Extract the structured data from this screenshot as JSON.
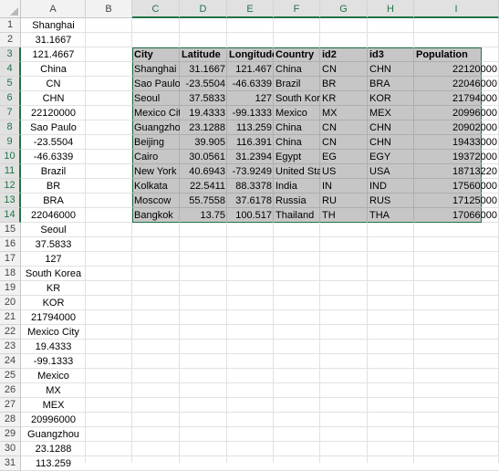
{
  "column_headers": [
    "A",
    "B",
    "C",
    "D",
    "E",
    "F",
    "G",
    "H",
    "I"
  ],
  "row_numbers": [
    "1",
    "2",
    "3",
    "4",
    "5",
    "6",
    "7",
    "8",
    "9",
    "10",
    "11",
    "12",
    "13",
    "14",
    "15",
    "16",
    "17",
    "18",
    "19",
    "20",
    "21",
    "22",
    "23",
    "24",
    "25",
    "26",
    "27",
    "28",
    "29",
    "30",
    "31"
  ],
  "column_a": [
    "Shanghai",
    "31.1667",
    "121.4667",
    "China",
    "CN",
    "CHN",
    "22120000",
    "Sao Paulo",
    "-23.5504",
    "-46.6339",
    "Brazil",
    "BR",
    "BRA",
    "22046000",
    "Seoul",
    "37.5833",
    "127",
    "South Korea",
    "KR",
    "KOR",
    "21794000",
    "Mexico City",
    "19.4333",
    "-99.1333",
    "Mexico",
    "MX",
    "MEX",
    "20996000",
    "Guangzhou",
    "23.1288",
    "113.259"
  ],
  "table": {
    "headers": [
      "City",
      "Latitude",
      "Longitude",
      "Country",
      "id2",
      "id3",
      "Population"
    ],
    "rows": [
      [
        "Shanghai",
        "31.1667",
        "121.467",
        "China",
        "CN",
        "CHN",
        "22120000"
      ],
      [
        "Sao Paulo",
        "-23.5504",
        "-46.6339",
        "Brazil",
        "BR",
        "BRA",
        "22046000"
      ],
      [
        "Seoul",
        "37.5833",
        "127",
        "South Korea",
        "KR",
        "KOR",
        "21794000"
      ],
      [
        "Mexico City",
        "19.4333",
        "-99.1333",
        "Mexico",
        "MX",
        "MEX",
        "20996000"
      ],
      [
        "Guangzhou",
        "23.1288",
        "113.259",
        "China",
        "CN",
        "CHN",
        "20902000"
      ],
      [
        "Beijing",
        "39.905",
        "116.391",
        "China",
        "CN",
        "CHN",
        "19433000"
      ],
      [
        "Cairo",
        "30.0561",
        "31.2394",
        "Egypt",
        "EG",
        "EGY",
        "19372000"
      ],
      [
        "New York",
        "40.6943",
        "-73.9249",
        "United States",
        "US",
        "USA",
        "18713220"
      ],
      [
        "Kolkata",
        "22.5411",
        "88.3378",
        "India",
        "IN",
        "IND",
        "17560000"
      ],
      [
        "Moscow",
        "55.7558",
        "37.6178",
        "Russia",
        "RU",
        "RUS",
        "17125000"
      ],
      [
        "Bangkok",
        "13.75",
        "100.517",
        "Thailand",
        "TH",
        "THA",
        "17066000"
      ]
    ]
  },
  "colors": {
    "accent": "#217346",
    "selection_fill": "#c6c6c6",
    "header_bg": "#f2f2f2"
  }
}
